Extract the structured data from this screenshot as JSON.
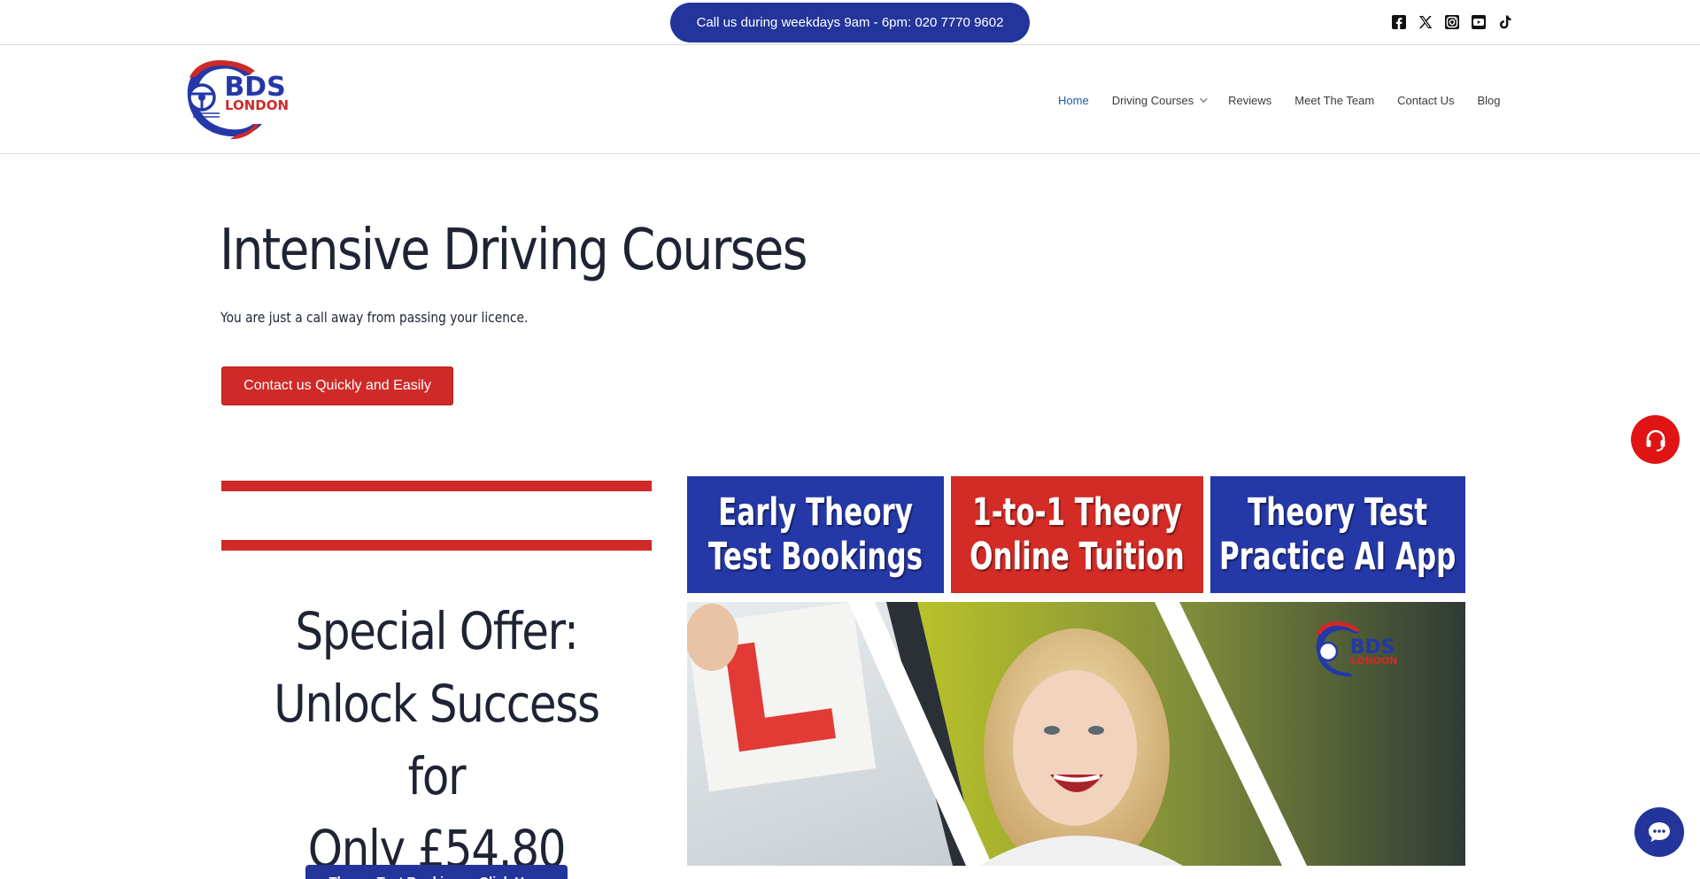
{
  "topbar": {
    "call_text": "Call us during weekdays 9am - 6pm: 020 7770 9602",
    "social": [
      "facebook-icon",
      "x-twitter-icon",
      "instagram-icon",
      "youtube-icon",
      "tiktok-icon"
    ]
  },
  "header": {
    "logo": {
      "top": "BDS",
      "bottom": "LONDON"
    },
    "nav": [
      {
        "label": "Home",
        "active": true
      },
      {
        "label": "Driving Courses",
        "dropdown": true
      },
      {
        "label": "Reviews"
      },
      {
        "label": "Meet The Team"
      },
      {
        "label": "Contact Us"
      },
      {
        "label": "Blog"
      }
    ]
  },
  "hero": {
    "title": "Intensive Driving Courses",
    "subtitle": "You are just a call away from passing your licence.",
    "cta": "Contact us Quickly and Easily"
  },
  "offer": {
    "line1": "Special Offer:",
    "line2": "Unlock Success for",
    "line3": "Only £54.80",
    "button": "Theory Test Bookings - Click Here"
  },
  "tiles": [
    {
      "line1": "Early Theory",
      "line2": "Test Bookings",
      "color": "#2438a8"
    },
    {
      "line1": "1-to-1 Theory",
      "line2": "Online Tuition",
      "color": "#d32b25"
    },
    {
      "line1": "Theory Test",
      "line2": "Practice AI App",
      "color": "#2438a8"
    }
  ],
  "photo": {
    "logo_top": "BDS",
    "logo_bottom": "LONDON"
  },
  "colors": {
    "brand_blue": "#23359a",
    "brand_red": "#cf2a27",
    "support_red": "#e01414",
    "link_active": "#1e5aa8"
  }
}
